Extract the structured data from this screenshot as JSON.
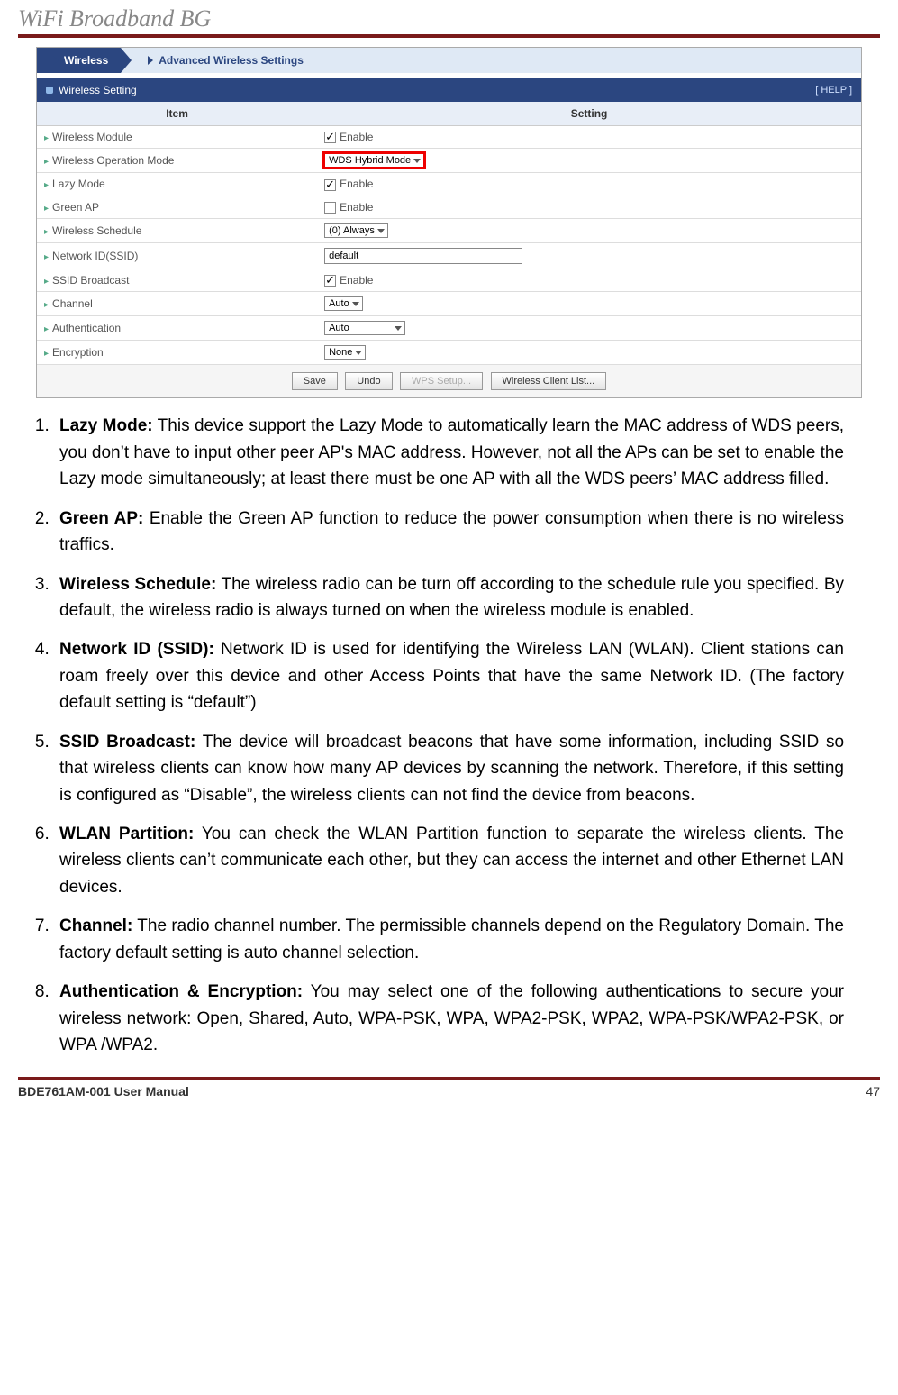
{
  "header": {
    "title": "WiFi Broadband BG"
  },
  "screenshot": {
    "breadcrumb": {
      "first": "Wireless",
      "second": "Advanced Wireless Settings"
    },
    "section_title": "Wireless  Setting",
    "help": "[ HELP ]",
    "columns": {
      "item": "Item",
      "setting": "Setting"
    },
    "rows": [
      {
        "label": "Wireless Module",
        "type": "checkbox",
        "checked": true,
        "text": "Enable"
      },
      {
        "label": "Wireless Operation Mode",
        "type": "select",
        "value": "WDS Hybrid Mode",
        "highlight": true
      },
      {
        "label": "Lazy Mode",
        "type": "checkbox",
        "checked": true,
        "text": "Enable"
      },
      {
        "label": "Green AP",
        "type": "checkbox",
        "checked": false,
        "text": "Enable"
      },
      {
        "label": "Wireless Schedule",
        "type": "select",
        "value": "(0) Always"
      },
      {
        "label": "Network ID(SSID)",
        "type": "text",
        "value": "default"
      },
      {
        "label": "SSID Broadcast",
        "type": "checkbox",
        "checked": true,
        "text": "Enable"
      },
      {
        "label": "Channel",
        "type": "select",
        "value": "Auto"
      },
      {
        "label": "Authentication",
        "type": "select",
        "value": "Auto",
        "wide": true
      },
      {
        "label": "Encryption",
        "type": "select",
        "value": "None"
      }
    ],
    "buttons": {
      "save": "Save",
      "undo": "Undo",
      "wps": "WPS Setup...",
      "clients": "Wireless Client List..."
    }
  },
  "list": [
    {
      "term": "Lazy Mode:",
      "body": " This device support the Lazy Mode to automatically learn the MAC address of WDS peers, you don’t have to input other peer AP's MAC address. However, not all the APs can be set to enable the Lazy mode simultaneously; at least there must be one AP with all the WDS peers’ MAC address filled."
    },
    {
      "term": "Green AP:",
      "body": " Enable the Green AP function to reduce the power consumption when there is no wireless traffics."
    },
    {
      "term": "Wireless Schedule:",
      "body": " The wireless radio can be turn off according to the schedule rule you specified. By default, the wireless radio is always turned on when the wireless module is enabled."
    },
    {
      "term": "Network ID (SSID):",
      "body": " Network ID is used for identifying the Wireless LAN (WLAN). Client stations can roam freely over this device and other Access Points that have the same Network ID. (The factory default setting is “default”)"
    },
    {
      "term": "SSID Broadcast:",
      "body": " The device will broadcast beacons that have some information, including SSID so that wireless clients can know how many AP devices by scanning the network. Therefore, if this setting is configured as “Disable”, the wireless clients can not find the device from beacons."
    },
    {
      "term": "WLAN Partition:",
      "body": " You can check the WLAN Partition function to separate the wireless clients. The wireless clients can’t communicate each other, but they can access the internet and other Ethernet LAN devices."
    },
    {
      "term": "Channel:",
      "body": " The radio channel number. The permissible channels depend on the Regulatory Domain. The factory default setting is auto channel selection."
    },
    {
      "term": "Authentication & Encryption:",
      "body": " You may select one of the following authentications to secure your wireless network: Open, Shared, Auto, WPA-PSK, WPA, WPA2-PSK, WPA2, WPA-PSK/WPA2-PSK, or WPA /WPA2."
    }
  ],
  "footer": {
    "left": "BDE761AM-001    User Manual",
    "right": "47"
  }
}
